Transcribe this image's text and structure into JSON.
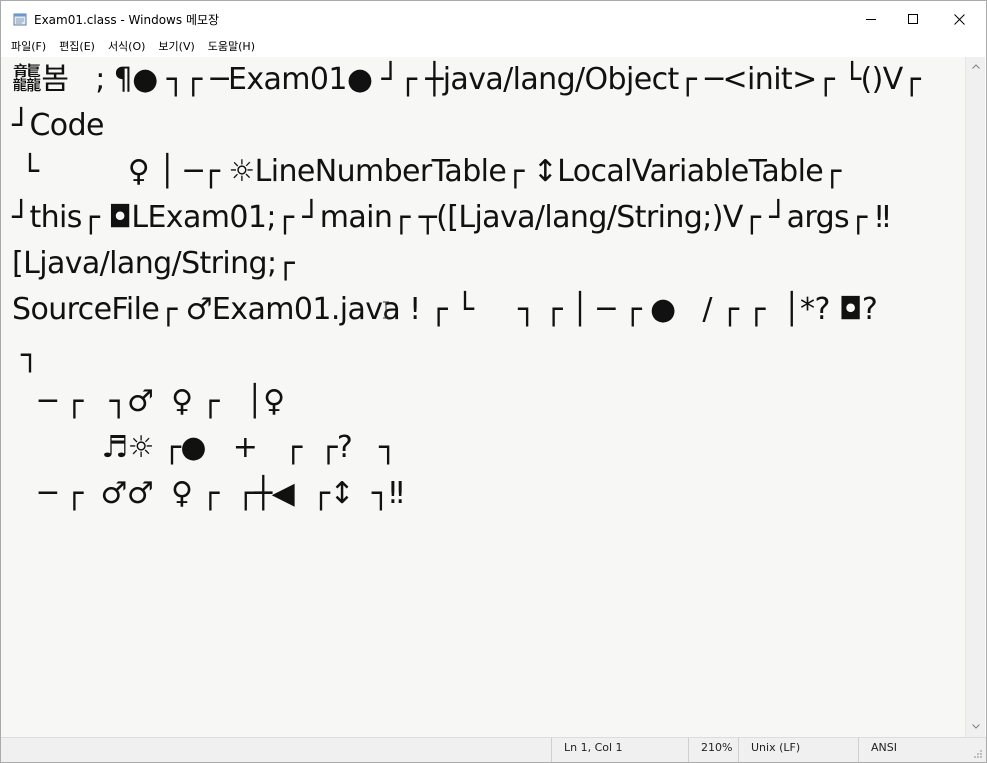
{
  "window": {
    "title": "Exam01.class - Windows 메모장",
    "controls": {
      "minimize": "minimize",
      "maximize": "maximize",
      "close": "close"
    }
  },
  "menu": {
    "items": [
      {
        "label": "파일(F)"
      },
      {
        "label": "편집(E)"
      },
      {
        "label": "서식(O)"
      },
      {
        "label": "보기(V)"
      },
      {
        "label": "도움말(H)"
      }
    ]
  },
  "editor": {
    "lines": [
      "龘봄   ; ¶● ┐┌ ─Exam01● ┘┌ ┼java/lang/Object┌ ─<init>┌ └()V┌",
      "┘Code",
      " └          ♀ │ ─┌ ☼LineNumberTable┌ ↕LocalVariableTable┌",
      "┘this┌ ◘LExam01;┌ ┘main┌ ┬([Ljava/lang/String;)V┌ ┘args┌ ‼",
      "[Ljava/lang/String;┌",
      "SourceFile┌ ♂Exam01.java ! ┌ └     ┐ ┌ │ ─ ┌ ●   / ┌ ┌  │*? ◘?",
      " ┐",
      "   ─ ┌   ┐♂  ♀ ┌   │♀",
      "          ♬☼ ┌●   +   ┌  ┌?   ┐",
      "   ─ ┌  ♂♂  ♀ ┌  ┌┼◀  ┌↕  ┐‼"
    ]
  },
  "status": {
    "position": "Ln 1, Col 1",
    "zoom": "210%",
    "line_ending": "Unix (LF)",
    "encoding": "ANSI"
  },
  "icons": {
    "app": "notepad-icon",
    "minimize": "minimize-icon",
    "maximize": "maximize-icon",
    "close": "close-icon",
    "scroll_up": "chevron-up-icon",
    "scroll_down": "chevron-down-icon",
    "resize": "resize-grip-icon"
  }
}
